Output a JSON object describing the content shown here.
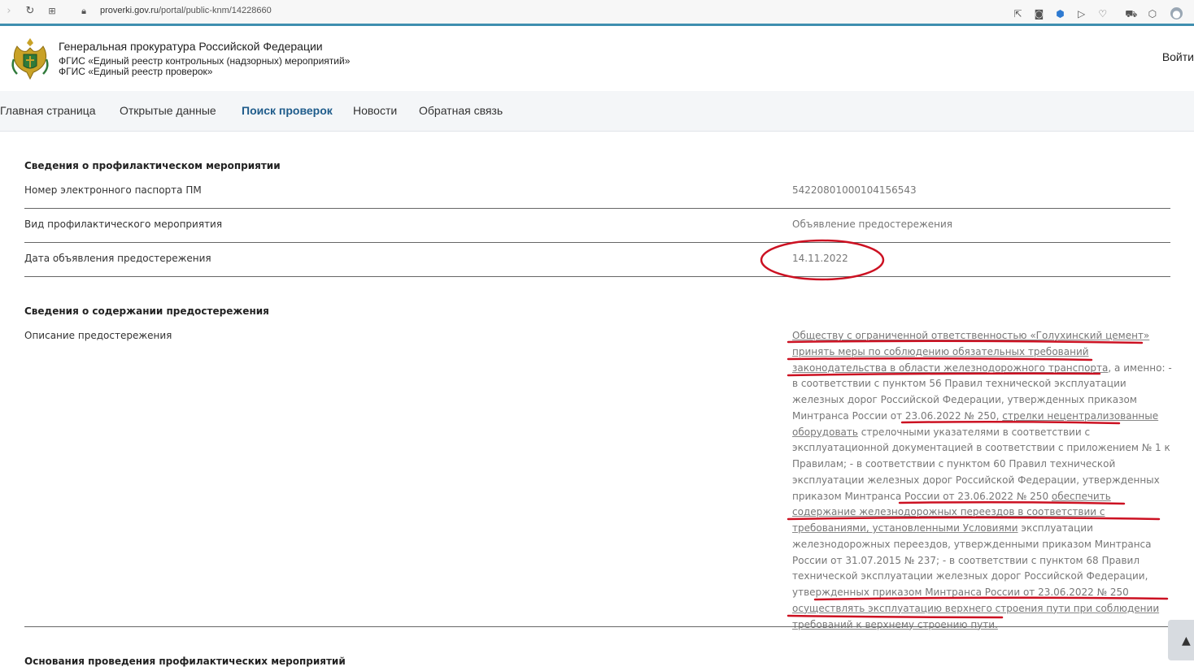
{
  "browser": {
    "url_host": "proverki.gov.ru",
    "url_path": "/portal/public-knm/14228660"
  },
  "header": {
    "title": "Генеральная прокуратура Российской Федерации",
    "subtitle_1": "ФГИС «Единый реестр контрольных (надзорных) мероприятий»",
    "subtitle_2": "ФГИС «Единый реестр проверок»",
    "login": "Войти"
  },
  "nav": {
    "items": [
      {
        "label": "Главная страница"
      },
      {
        "label": "Открытые данные"
      },
      {
        "label": "Поиск проверок"
      },
      {
        "label": "Новости"
      },
      {
        "label": "Обратная связь"
      }
    ]
  },
  "section1": {
    "title": "Сведения о профилактическом мероприятии",
    "rows": [
      {
        "label": "Номер электронного паспорта ПМ",
        "value": "54220801000104156543"
      },
      {
        "label": "Вид профилактического мероприятия",
        "value": "Объявление предостережения"
      },
      {
        "label": "Дата объявления предостережения",
        "value": "14.11.2022"
      }
    ]
  },
  "section2": {
    "title": "Сведения о содержании предостережения",
    "label": "Описание предостережения",
    "description": [
      "Обществу с ограниченной ответственностью «Голухинский цемент»",
      "принять меры по соблюдению обязательных требований",
      "законодательства в области железнодорожного транспорта",
      ", а именно: - в соответствии с пунктом 56 Правил технической эксплуатации железных дорог Российской Федерации, утвержденных приказом Минтранса России от 23.06.2022 № 250, ",
      "стрелки нецентрализованные оборудовать",
      " стрелочными указателями в соответствии с эксплуатационной документацией в соответствии с приложением № 1 к Правилам; - в соответствии с пунктом 60 Правил технической эксплуатации железных дорог Российской Федерации, утвержденных приказом Минтранса России от 23.06.2022 № 250 ",
      "обеспечить содержание железнодорожных переездов в соответствии с требованиями, установленными Условиями",
      " эксплуатации железнодорожных переездов, утвержденными приказом Минтранса России от 31.07.2015 № 237; - в соответствии с пунктом 68 Правил технической эксплуатации железных дорог Российской Федерации, утвержденных приказом Минтранса России от 23.06.2022 № 250 ",
      "осуществлять эксплуатацию верхнего строения пути при соблюдении требований к верхнему строению пути."
    ]
  },
  "section3": {
    "title": "Основания проведения профилактических мероприятий"
  },
  "colors": {
    "accent": "#1f5c8b",
    "annotation": "#cc1122",
    "browser_line": "#3f8fb0"
  }
}
